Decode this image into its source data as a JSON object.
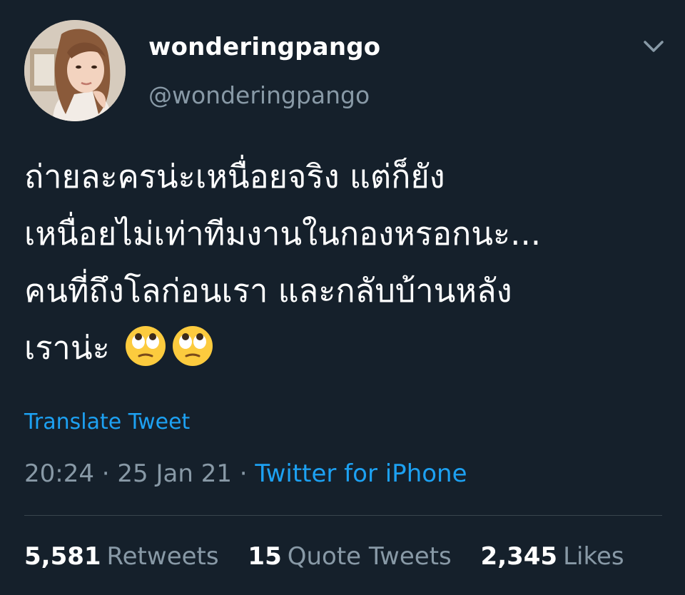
{
  "user": {
    "display_name": "wonderingpango",
    "handle": "@wonderingpango"
  },
  "tweet": {
    "lines": [
      "ถ่ายละครน่ะเหนื่อยจริง แต่ก็ยัง",
      "เหนื่อยไม่เท่าทีมงานในกองหรอกนะ...",
      "คนที่ถึงโลก่อนเรา และกลับบ้านหลัง",
      "เราน่ะ"
    ],
    "emojis": [
      "face-with-rolling-eyes-icon",
      "face-with-rolling-eyes-icon"
    ],
    "translate_label": "Translate Tweet"
  },
  "meta": {
    "time": "20:24",
    "separator": "·",
    "date": "25 Jan 21",
    "source": "Twitter for iPhone"
  },
  "stats": {
    "retweets_count": "5,581",
    "retweets_label": "Retweets",
    "quotes_count": "15",
    "quotes_label": "Quote Tweets",
    "likes_count": "2,345",
    "likes_label": "Likes"
  },
  "colors": {
    "background": "#15202b",
    "accent": "#1da1f2",
    "secondary_text": "#8899a6",
    "divider": "#38444d"
  }
}
